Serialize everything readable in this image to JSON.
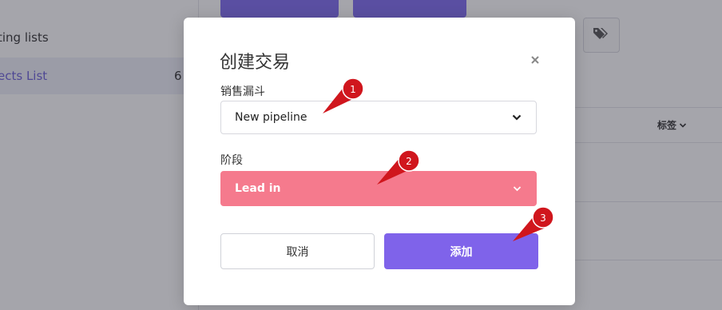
{
  "background": {
    "sidebar": {
      "items": [
        {
          "label": "ting lists",
          "count": ""
        },
        {
          "label": "ects List",
          "count": "6"
        }
      ]
    },
    "table": {
      "tags_header": "标签"
    }
  },
  "modal": {
    "title": "创建交易",
    "close_label": "×",
    "pipeline_label": "销售漏斗",
    "pipeline_value": "New pipeline",
    "stage_label": "阶段",
    "stage_value": "Lead in",
    "cancel_label": "取消",
    "add_label": "添加"
  },
  "callouts": [
    "1",
    "2",
    "3"
  ],
  "colors": {
    "accent": "#7f63ea",
    "stage": "#f57a8d",
    "callout": "#d0161d"
  }
}
